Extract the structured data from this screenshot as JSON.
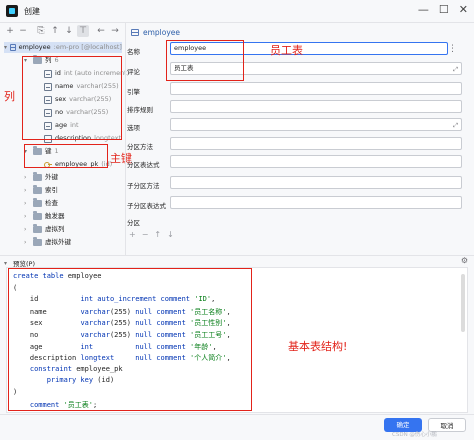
{
  "window": {
    "title": "创建",
    "min": "—",
    "max": "☐",
    "close": "✕"
  },
  "toolbar": {
    "add": "+",
    "remove": "−",
    "copy": "⎘",
    "up": "↑",
    "down": "↓",
    "filter": "⊤",
    "back": "←",
    "forward": "→"
  },
  "tree": {
    "table": {
      "name": "employee",
      "meta": ":em-pro [@localhost]"
    },
    "columns_folder": {
      "label": "列",
      "count": "6"
    },
    "columns": [
      {
        "name": "id",
        "type": "int (auto increment)"
      },
      {
        "name": "name",
        "type": "varchar(255)"
      },
      {
        "name": "sex",
        "type": "varchar(255)"
      },
      {
        "name": "no",
        "type": "varchar(255)"
      },
      {
        "name": "age",
        "type": "int"
      },
      {
        "name": "description",
        "type": "longtext"
      }
    ],
    "keys_folder": {
      "label": "键",
      "count": "1"
    },
    "key": {
      "name": "employee_pk",
      "type": "(id)"
    },
    "other_folders": [
      "外键",
      "索引",
      "检查",
      "触发器",
      "虚拟列",
      "虚拟外键"
    ]
  },
  "annotations": {
    "columns": "列",
    "primary_key": "主键",
    "table_name": "员工表",
    "structure": "基本表结构!"
  },
  "form": {
    "header": "employee",
    "fields": [
      {
        "label": "名称",
        "value": "employee"
      },
      {
        "label": "评论",
        "value": "员工表"
      },
      {
        "label": "引擎",
        "value": ""
      },
      {
        "label": "排序规则",
        "value": ""
      },
      {
        "label": "选项",
        "value": ""
      },
      {
        "label": "分区方法",
        "value": ""
      },
      {
        "label": "分区表达式",
        "value": ""
      },
      {
        "label": "子分区方法",
        "value": ""
      },
      {
        "label": "子分区表达式",
        "value": ""
      }
    ],
    "partition_label": "分区",
    "partition_tools": [
      "+",
      "−",
      "↑",
      "↓"
    ]
  },
  "preview": {
    "title": "预览(P)",
    "lines": [
      [
        {
          "t": "create table ",
          "c": "kw"
        },
        {
          "t": "employee",
          "c": ""
        }
      ],
      [
        {
          "t": "(",
          "c": ""
        }
      ],
      [
        {
          "t": "    id          ",
          "c": ""
        },
        {
          "t": "int ",
          "c": "kw"
        },
        {
          "t": "auto_increment comment ",
          "c": "kw"
        },
        {
          "t": "'ID'",
          "c": "str"
        },
        {
          "t": ",",
          "c": ""
        }
      ],
      [
        {
          "t": "    name        ",
          "c": ""
        },
        {
          "t": "varchar",
          "c": "kw"
        },
        {
          "t": "(255) ",
          "c": ""
        },
        {
          "t": "null comment ",
          "c": "kw"
        },
        {
          "t": "'员工名称'",
          "c": "str"
        },
        {
          "t": ",",
          "c": ""
        }
      ],
      [
        {
          "t": "    sex         ",
          "c": ""
        },
        {
          "t": "varchar",
          "c": "kw"
        },
        {
          "t": "(255) ",
          "c": ""
        },
        {
          "t": "null comment ",
          "c": "kw"
        },
        {
          "t": "'员工性别'",
          "c": "str"
        },
        {
          "t": ",",
          "c": ""
        }
      ],
      [
        {
          "t": "    no          ",
          "c": ""
        },
        {
          "t": "varchar",
          "c": "kw"
        },
        {
          "t": "(255) ",
          "c": ""
        },
        {
          "t": "null comment ",
          "c": "kw"
        },
        {
          "t": "'员工工号'",
          "c": "str"
        },
        {
          "t": ",",
          "c": ""
        }
      ],
      [
        {
          "t": "    age         ",
          "c": ""
        },
        {
          "t": "int          ",
          "c": "kw"
        },
        {
          "t": "null comment ",
          "c": "kw"
        },
        {
          "t": "'年龄'",
          "c": "str"
        },
        {
          "t": ",",
          "c": ""
        }
      ],
      [
        {
          "t": "    description ",
          "c": ""
        },
        {
          "t": "longtext     ",
          "c": "kw"
        },
        {
          "t": "null comment ",
          "c": "kw"
        },
        {
          "t": "'个人简介'",
          "c": "str"
        },
        {
          "t": ",",
          "c": ""
        }
      ],
      [
        {
          "t": "    constraint ",
          "c": "kw"
        },
        {
          "t": "employee_pk",
          "c": ""
        }
      ],
      [
        {
          "t": "        primary key ",
          "c": "kw"
        },
        {
          "t": "(id)",
          "c": ""
        }
      ],
      [
        {
          "t": ")",
          "c": ""
        }
      ],
      [
        {
          "t": "    comment ",
          "c": "kw"
        },
        {
          "t": "'员工表'",
          "c": "str"
        },
        {
          "t": ";",
          "c": ""
        }
      ]
    ]
  },
  "buttons": {
    "ok": "确定",
    "cancel": "取消"
  },
  "watermark": "CSDN @伤心小鹏"
}
